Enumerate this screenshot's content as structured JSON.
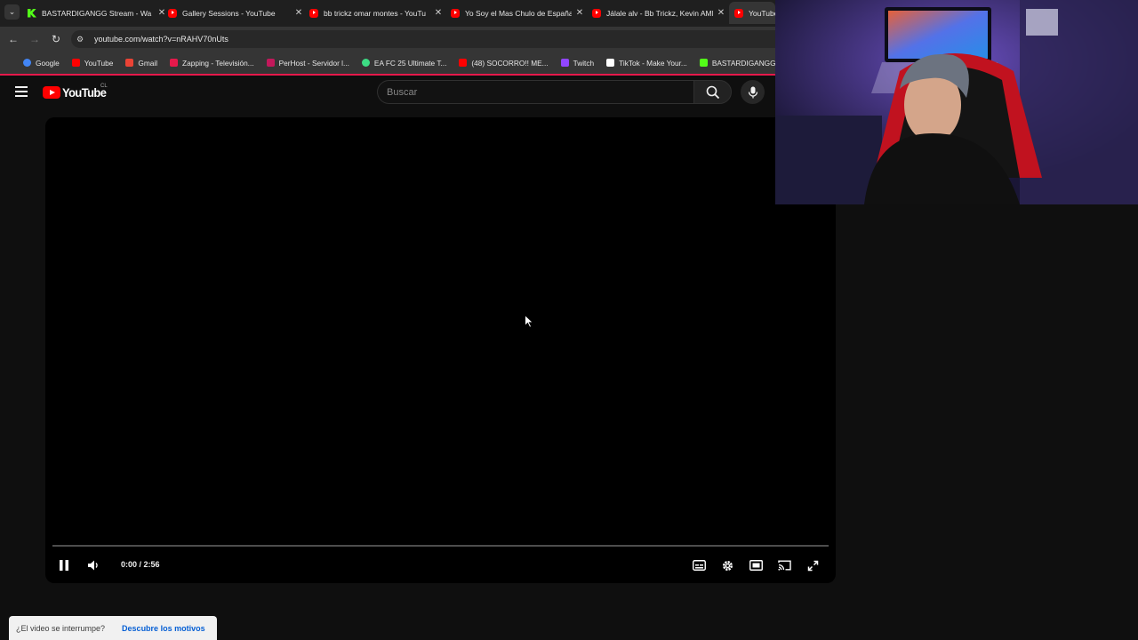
{
  "browser": {
    "tabs": [
      {
        "title": "BASTARDIGANGG Stream - Wa",
        "icon": "kick-icon",
        "active": false
      },
      {
        "title": "Gallery Sessions - YouTube",
        "icon": "youtube-icon",
        "active": false
      },
      {
        "title": "bb trickz omar montes - YouTu",
        "icon": "youtube-icon",
        "active": false
      },
      {
        "title": "Yo Soy el Mas Chulo de España",
        "icon": "youtube-icon",
        "active": false
      },
      {
        "title": "Jálale alv - Bb Trickz, Kevin AMF",
        "icon": "youtube-icon",
        "active": false
      },
      {
        "title": "YouTube",
        "icon": "youtube-icon",
        "active": true
      }
    ],
    "url": "youtube.com/watch?v=nRAHV70nUts",
    "bookmarks": [
      {
        "label": "Google",
        "icon": "google-icon",
        "color": "#4285f4"
      },
      {
        "label": "YouTube",
        "icon": "youtube-icon",
        "color": "#ff0000"
      },
      {
        "label": "Gmail",
        "icon": "gmail-icon",
        "color": "#ea4335"
      },
      {
        "label": "Zapping - Televisión...",
        "icon": "zapping-icon",
        "color": "#e6194b"
      },
      {
        "label": "PerHost - Servidor l...",
        "icon": "perhost-icon",
        "color": "#c2185b"
      },
      {
        "label": "EA FC 25 Ultimate T...",
        "icon": "futbin-icon",
        "color": "#3ddc84"
      },
      {
        "label": "(48) SOCORRO!! ME...",
        "icon": "youtube-icon",
        "color": "#ff0000"
      },
      {
        "label": "Twitch",
        "icon": "twitch-icon",
        "color": "#9146ff"
      },
      {
        "label": "TikTok - Make Your...",
        "icon": "tiktok-icon",
        "color": "#ffffff"
      },
      {
        "label": "BASTARDIGANGG |...",
        "icon": "kick-icon",
        "color": "#53fc18"
      }
    ]
  },
  "youtube": {
    "logo_text": "YouTube",
    "country_code": "CL",
    "search_placeholder": "Buscar",
    "player": {
      "time": "0:00 / 2:56",
      "progress": 0,
      "state": "playing"
    },
    "toast": {
      "text": "¿El video se interrumpe?",
      "link": "Descubre los motivos"
    }
  }
}
